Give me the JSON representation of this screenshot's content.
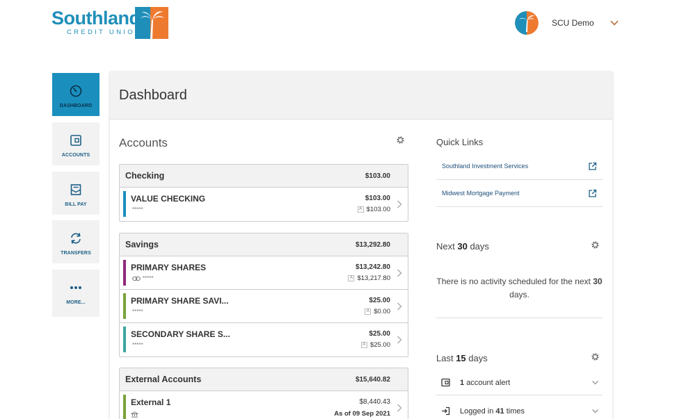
{
  "brand": {
    "name": "Southland",
    "sub": "CREDIT UNION",
    "colors": {
      "blue": "#1f8fb9",
      "orange": "#ee7a30",
      "active_nav": "#1a8fbd"
    }
  },
  "user": {
    "name": "SCU Demo"
  },
  "nav": [
    {
      "label": "DASHBOARD",
      "icon": "gauge-icon"
    },
    {
      "label": "ACCOUNTS",
      "icon": "wallet-icon"
    },
    {
      "label": "BILL PAY",
      "icon": "envelope-icon"
    },
    {
      "label": "TRANSFERS",
      "icon": "transfer-arrows-icon"
    },
    {
      "label": "MORE...",
      "icon": "ellipsis-icon"
    }
  ],
  "page": {
    "title": "Dashboard"
  },
  "accounts": {
    "title": "Accounts",
    "groups": [
      {
        "name": "Checking",
        "total": "$103.00",
        "items": [
          {
            "name": "VALUE CHECKING",
            "mask": "*****",
            "balance": "$103.00",
            "available": "$103.00",
            "color": "#1a8fbd"
          }
        ]
      },
      {
        "name": "Savings",
        "total": "$13,292.80",
        "items": [
          {
            "name": "PRIMARY SHARES",
            "mask": "*****",
            "balance": "$13,242.80",
            "available": "$13,217.80",
            "color": "#8e2a7d"
          },
          {
            "name": "PRIMARY SHARE SAVI...",
            "mask": "*****",
            "balance": "$25.00",
            "available": "$0.00",
            "color": "#7aa23c"
          },
          {
            "name": "SECONDARY SHARE S...",
            "mask": "*****",
            "balance": "$25.00",
            "available": "$25.00",
            "color": "#3fa6a0"
          }
        ]
      },
      {
        "name": "External Accounts",
        "total": "$15,640.82",
        "items": [
          {
            "name": "External 1",
            "balance": "$8,440.43",
            "asof": "As of 09 Sep 2021",
            "color": "#7aa23c"
          }
        ]
      }
    ]
  },
  "quick_links": {
    "title": "Quick Links",
    "items": [
      {
        "label": "Southland Investment Services"
      },
      {
        "label": "Midwest Mortgage Payment"
      }
    ]
  },
  "next_days": {
    "prefix": "Next",
    "count": "30",
    "suffix": "days",
    "message_pre": "There is no activity scheduled for the next",
    "message_num": "30",
    "message_post": "days."
  },
  "last_days": {
    "prefix": "Last",
    "count": "15",
    "suffix": "days",
    "rows": [
      {
        "count": "1",
        "text": "account alert"
      },
      {
        "pre": "Logged in",
        "count": "41",
        "post": "times"
      }
    ]
  }
}
